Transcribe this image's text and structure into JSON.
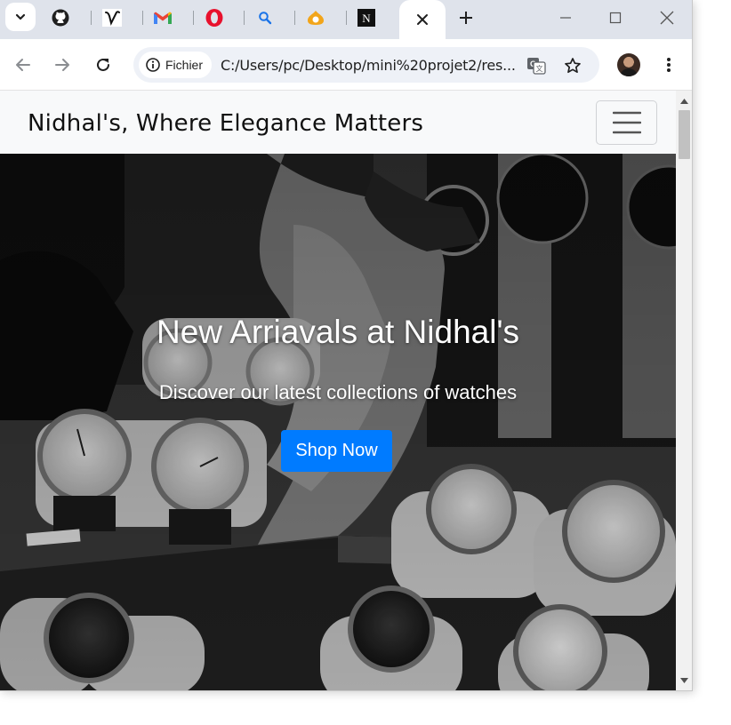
{
  "browser": {
    "tabs": [
      {
        "icon": "github-icon"
      },
      {
        "icon": "v-logo-icon"
      },
      {
        "icon": "gmail-icon"
      },
      {
        "icon": "opera-icon"
      },
      {
        "icon": "search-icon"
      },
      {
        "icon": "bread-icon"
      },
      {
        "icon": "n-logo-icon",
        "active": true
      }
    ],
    "site_chip": "Fichier",
    "url": "C:/Users/pc/Desktop/mini%20projet2/res..."
  },
  "page": {
    "brand": "Nidhal's, Where Elegance Matters",
    "hero": {
      "title": "New Arriavals at Nidhal's",
      "subtitle": "Discover our latest collections of watches",
      "cta": "Shop Now"
    },
    "colors": {
      "navbar_bg": "#f8f9fa",
      "cta_bg": "#007bff",
      "hero_text": "#ffffff"
    }
  }
}
